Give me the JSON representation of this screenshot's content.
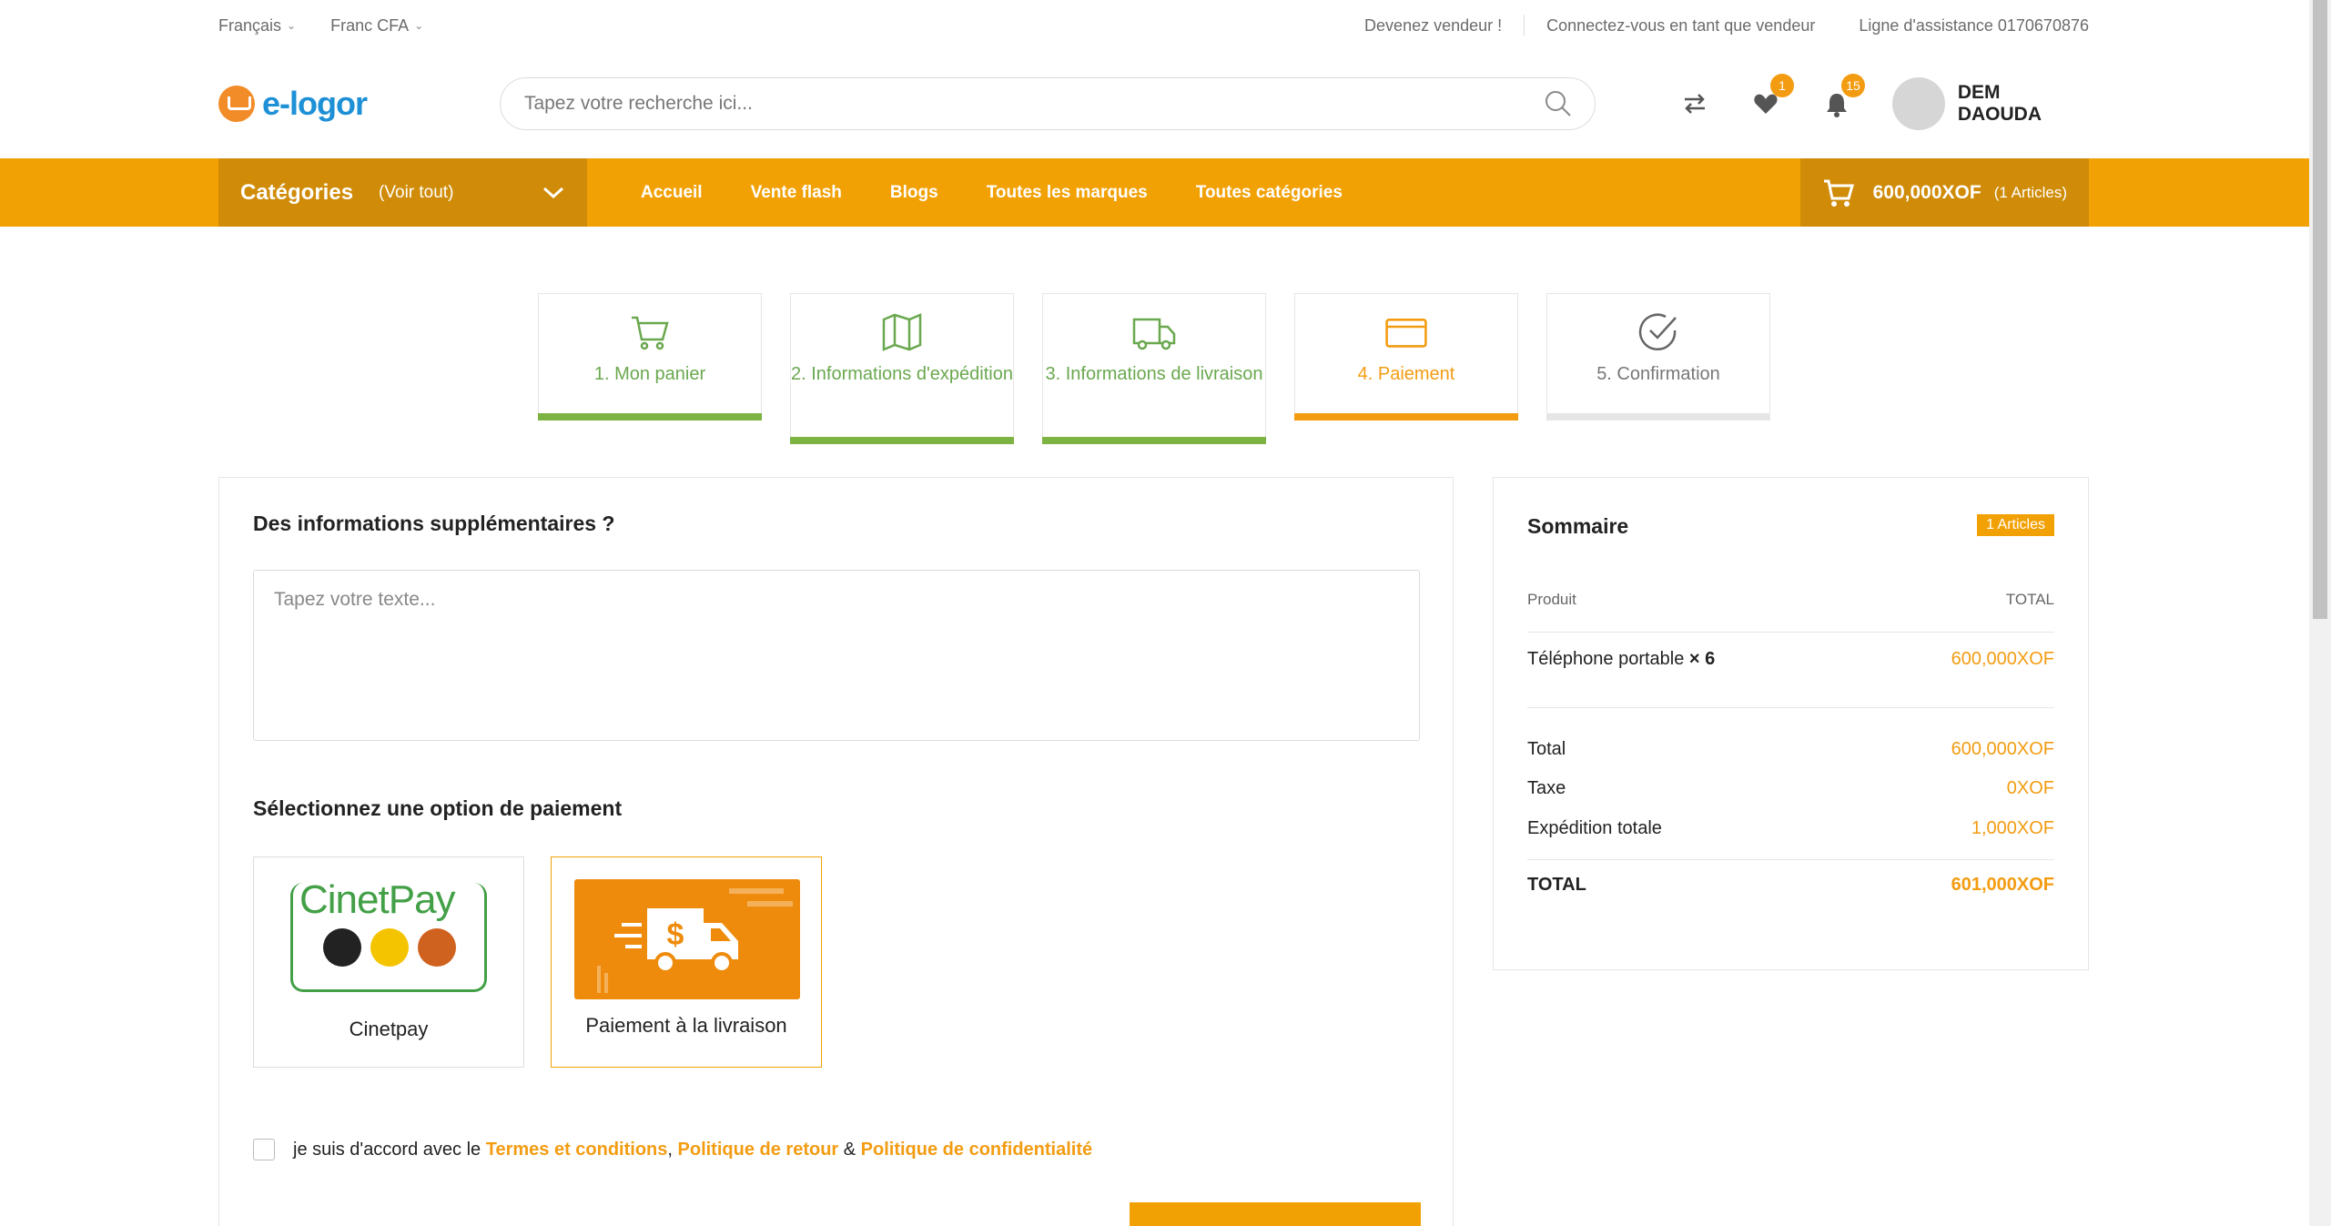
{
  "topbar": {
    "language": "Français",
    "currency": "Franc CFA",
    "become_seller": "Devenez vendeur !",
    "login_seller": "Connectez-vous en tant que vendeur",
    "helpline": "Ligne d'assistance 0170670876"
  },
  "header": {
    "logo_text": "e-logor",
    "search_placeholder": "Tapez votre recherche ici...",
    "wishlist_count": "1",
    "notifications_count": "15",
    "user_name": "DEM DAOUDA"
  },
  "nav": {
    "categories_label": "Catégories",
    "see_all": "(Voir tout)",
    "links": [
      "Accueil",
      "Vente flash",
      "Blogs",
      "Toutes les marques",
      "Toutes catégories"
    ],
    "cart_amount": "600,000XOF",
    "cart_count": "(1 Articles)"
  },
  "steps": [
    {
      "label": "1. Mon panier",
      "state": "done",
      "icon": "cart-icon"
    },
    {
      "label": "2. Informations d'expédition",
      "state": "done",
      "icon": "map-icon"
    },
    {
      "label": "3. Informations de livraison",
      "state": "done",
      "icon": "truck-icon"
    },
    {
      "label": "4. Paiement",
      "state": "active",
      "icon": "credit-card-icon"
    },
    {
      "label": "5. Confirmation",
      "state": "todo",
      "icon": "check-circle-icon"
    }
  ],
  "main": {
    "extra_info_title": "Des informations supplémentaires ?",
    "textarea_placeholder": "Tapez votre texte...",
    "payment_title": "Sélectionnez une option de paiement",
    "payment_options": [
      {
        "name": "Cinetpay",
        "selected": false,
        "logo_text": "CinetPay"
      },
      {
        "name": "Paiement à la livraison",
        "selected": true
      }
    ],
    "terms_prefix": "je suis d'accord avec le",
    "terms_link": "Termes et conditions",
    "comma": ",",
    "return_link": "Politique de retour",
    "amp": "&",
    "privacy_link": "Politique de confidentialité"
  },
  "summary": {
    "title": "Sommaire",
    "badge": "1 Articles",
    "col_product": "Produit",
    "col_total": "TOTAL",
    "item_name": "Téléphone portable",
    "item_qty": "× 6",
    "item_price": "600,000XOF",
    "total_label": "Total",
    "total_value": "600,000XOF",
    "tax_label": "Taxe",
    "tax_value": "0XOF",
    "shipping_label": "Expédition totale",
    "shipping_value": "1,000XOF",
    "grand_label": "TOTAL",
    "grand_value": "601,000XOF"
  },
  "colors": {
    "accent": "#f2a105",
    "accent_dark": "#d08c08",
    "done_green": "#7cb342"
  }
}
